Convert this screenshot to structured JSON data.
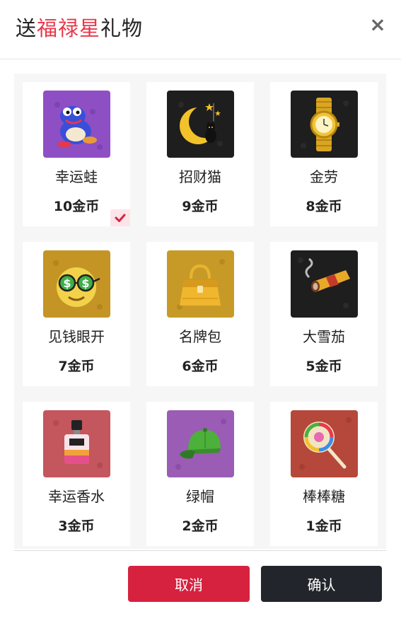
{
  "dialog": {
    "title_before": "送",
    "title_highlight": "福禄星",
    "title_after": "礼物",
    "close_label": "×"
  },
  "gifts": [
    {
      "name": "幸运蛙",
      "price": "10金币",
      "icon": "lucky-frog-icon",
      "bg": "#8e4fc4",
      "selected": true
    },
    {
      "name": "招财猫",
      "price": "9金币",
      "icon": "crescent-moon-cat-icon",
      "bg": "#1e1e1e"
    },
    {
      "name": "金劳",
      "price": "8金币",
      "icon": "gold-watch-icon",
      "bg": "#1e1e1e"
    },
    {
      "name": "见钱眼开",
      "price": "7金币",
      "icon": "dollar-glasses-face-icon",
      "bg": "#c49425"
    },
    {
      "name": "名牌包",
      "price": "6金币",
      "icon": "designer-handbag-icon",
      "bg": "#c79a28"
    },
    {
      "name": "大雪茄",
      "price": "5金币",
      "icon": "cigar-icon",
      "bg": "#1e1e1e"
    },
    {
      "name": "幸运香水",
      "price": "3金币",
      "icon": "perfume-bottle-icon",
      "bg": "#c4565e"
    },
    {
      "name": "绿帽",
      "price": "2金币",
      "icon": "green-cap-icon",
      "bg": "#9a5cb5"
    },
    {
      "name": "棒棒糖",
      "price": "1金币",
      "icon": "lollipop-icon",
      "bg": "#b5483a"
    }
  ],
  "buttons": {
    "cancel": "取消",
    "confirm": "确认"
  },
  "colors": {
    "title_highlight": "#e8374a",
    "cancel_button": "#d6223f",
    "confirm_button": "#22252b",
    "selected_check": "#d6223f"
  }
}
